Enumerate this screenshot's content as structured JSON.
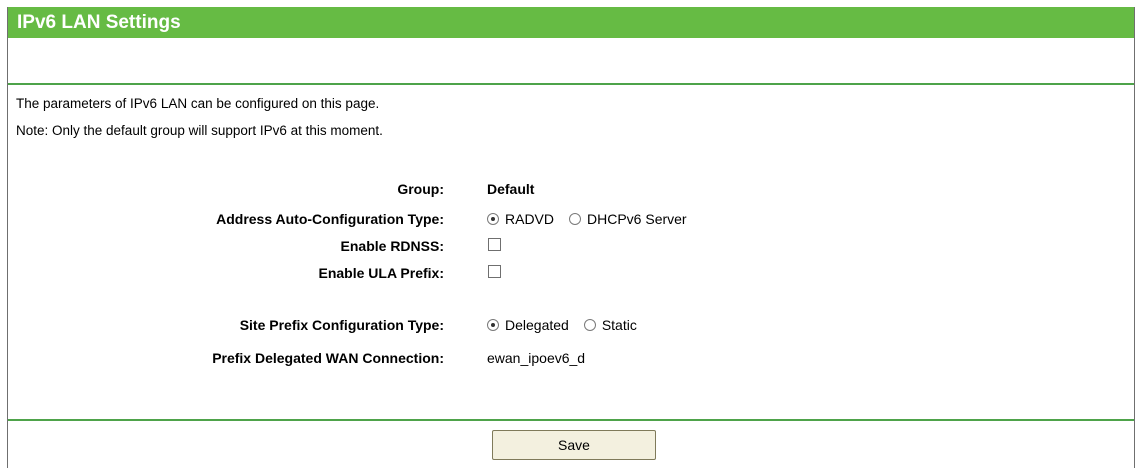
{
  "title": "IPv6 LAN Settings",
  "description": {
    "line1": "The parameters of IPv6 LAN can be configured on this page.",
    "line2": "Note: Only the default group will support IPv6 at this moment."
  },
  "form": {
    "group": {
      "label": "Group:",
      "value": "Default"
    },
    "address_auto_config": {
      "label": "Address Auto-Configuration Type:",
      "options": [
        "RADVD",
        "DHCPv6 Server"
      ],
      "selected": "RADVD"
    },
    "enable_rdnss": {
      "label": "Enable RDNSS:",
      "checked": false
    },
    "enable_ula_prefix": {
      "label": "Enable ULA Prefix:",
      "checked": false
    },
    "site_prefix_config": {
      "label": "Site Prefix Configuration Type:",
      "options": [
        "Delegated",
        "Static"
      ],
      "selected": "Delegated"
    },
    "prefix_delegated_wan": {
      "label": "Prefix Delegated WAN Connection:",
      "value": "ewan_ipoev6_d"
    }
  },
  "save_label": "Save",
  "colors": {
    "header_green": "#66bb44",
    "rule_green": "#4ea34a",
    "button_bg": "#f3f0df"
  }
}
